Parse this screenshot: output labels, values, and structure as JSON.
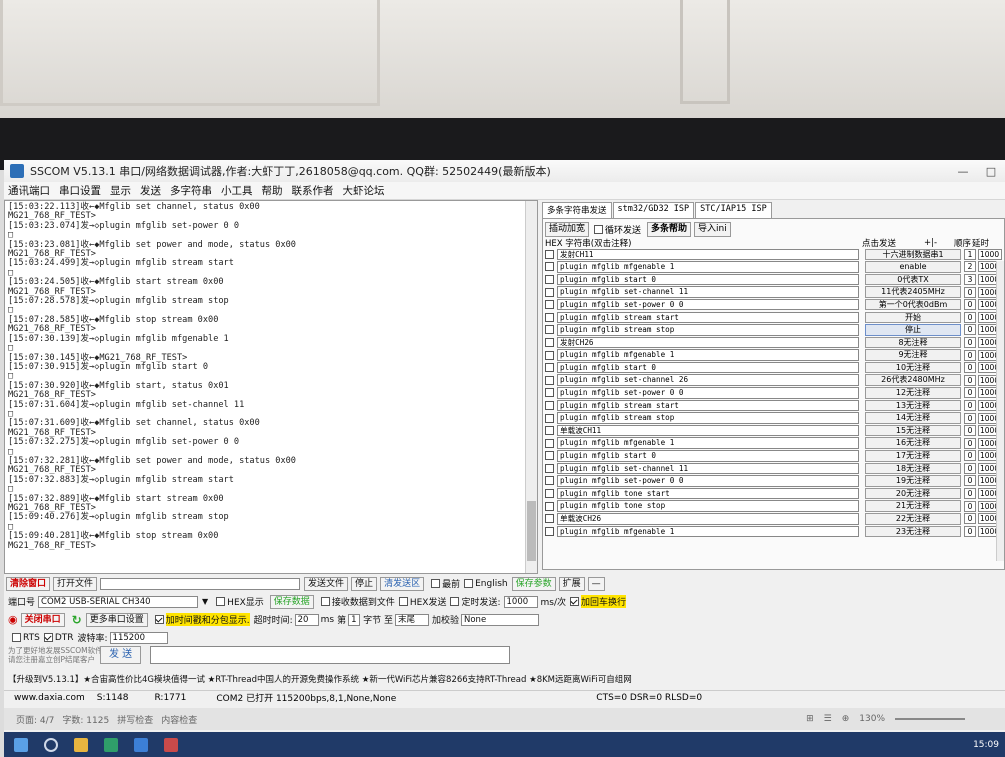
{
  "window": {
    "title": "SSCOM V5.13.1 串口/网络数据调试器,作者:大虾丁丁,2618058@qq.com. QQ群: 52502449(最新版本)",
    "minimize": "—",
    "maximize": "□"
  },
  "menu": [
    "通讯端口",
    "串口设置",
    "显示",
    "发送",
    "多字符串",
    "小工具",
    "帮助",
    "联系作者",
    "大虾论坛"
  ],
  "log_lines": [
    "[15:03:22.113]收←◆Mfglib set channel, status 0x00",
    "MG21_768_RF_TEST>",
    "[15:03:23.074]发→◇plugin mfglib set-power 0 0",
    "□",
    "[15:03:23.081]收←◆Mfglib set power and mode, status 0x00",
    "MG21_768_RF_TEST>",
    "[15:03:24.499]发→◇plugin mfglib stream start",
    "□",
    "[15:03:24.505]收←◆Mfglib start stream 0x00",
    "MG21_768_RF_TEST>",
    "[15:07:28.578]发→◇plugin mfglib stream stop",
    "□",
    "[15:07:28.585]收←◆Mfglib stop stream 0x00",
    "MG21_768_RF_TEST>",
    "[15:07:30.139]发→◇plugin mfglib mfgenable 1",
    "□",
    "[15:07:30.145]收←◆MG21_768_RF_TEST>",
    "[15:07:30.915]发→◇plugin mfglib start 0",
    "□",
    "[15:07:30.920]收←◆Mfglib start, status 0x01",
    "MG21_768_RF_TEST>",
    "[15:07:31.604]发→◇plugin mfglib set-channel 11",
    "□",
    "[15:07:31.609]收←◆Mfglib set channel, status 0x00",
    "MG21_768_RF_TEST>",
    "[15:07:32.275]发→◇plugin mfglib set-power 0 0",
    "□",
    "[15:07:32.281]收←◆Mfglib set power and mode, status 0x00",
    "MG21_768_RF_TEST>",
    "[15:07:32.883]发→◇plugin mfglib stream start",
    "□",
    "[15:07:32.889]收←◆Mfglib start stream 0x00",
    "MG21_768_RF_TEST>",
    "[15:09:40.276]发→◇plugin mfglib stream stop",
    "□",
    "[15:09:40.281]收←◆Mfglib stop stream 0x00",
    "MG21_768_RF_TEST>"
  ],
  "tabs": [
    "多条字符串发送",
    "stm32/GD32 ISP",
    "STC/IAP15 ISP"
  ],
  "multi_toolbar": {
    "insert": "插动加宽",
    "loop": "循环发送",
    "help": "多条帮助",
    "import": "导入ini"
  },
  "multi_header": {
    "hex_col": "HEX 字符串(双击注释)",
    "click_send": "点击发送",
    "order": "顺序",
    "delay": "延时",
    "unit": "ms",
    "sort_btns": "+|-"
  },
  "multi_rows": [
    {
      "text": "发射CH11",
      "btn": "十六进制数据串1",
      "ord": "1",
      "delay": "1000"
    },
    {
      "text": "plugin mfglib mfgenable 1",
      "btn": "enable",
      "ord": "2",
      "delay": "1000"
    },
    {
      "text": "plugin mfglib start 0",
      "btn": "0代表TX",
      "ord": "3",
      "delay": "1000"
    },
    {
      "text": "plugin mfglib set-channel 11",
      "btn": "11代表2405MHz",
      "ord": "0",
      "delay": "1000"
    },
    {
      "text": "plugin mfglib set-power 0 0",
      "btn": "第一个0代表0dBm",
      "ord": "0",
      "delay": "1000"
    },
    {
      "text": "plugin mfglib stream start",
      "btn": "开始",
      "ord": "0",
      "delay": "1000"
    },
    {
      "text": "plugin mfglib stream stop",
      "btn": "停止",
      "ord": "0",
      "delay": "1000"
    },
    {
      "text": "发射CH26",
      "btn": "8无注释",
      "ord": "0",
      "delay": "1000"
    },
    {
      "text": "plugin mfglib mfgenable 1",
      "btn": "9无注释",
      "ord": "0",
      "delay": "1000"
    },
    {
      "text": "plugin mfglib start 0",
      "btn": "10无注释",
      "ord": "0",
      "delay": "1000"
    },
    {
      "text": "plugin mfglib set-channel 26",
      "btn": "26代表2480MHz",
      "ord": "0",
      "delay": "1000"
    },
    {
      "text": "plugin mfglib set-power 0 0",
      "btn": "12无注释",
      "ord": "0",
      "delay": "1000"
    },
    {
      "text": "plugin mfglib stream start",
      "btn": "13无注释",
      "ord": "0",
      "delay": "1000"
    },
    {
      "text": "plugin mfglib stream stop",
      "btn": "14无注释",
      "ord": "0",
      "delay": "1000"
    },
    {
      "text": "单载波CH11",
      "btn": "15无注释",
      "ord": "0",
      "delay": "1000"
    },
    {
      "text": "plugin mfglib mfgenable 1",
      "btn": "16无注释",
      "ord": "0",
      "delay": "1000"
    },
    {
      "text": "plugin mfglib start 0",
      "btn": "17无注释",
      "ord": "0",
      "delay": "1000"
    },
    {
      "text": "plugin mfglib set-channel 11",
      "btn": "18无注释",
      "ord": "0",
      "delay": "1000"
    },
    {
      "text": "plugin mfglib set-power 0 0",
      "btn": "19无注释",
      "ord": "0",
      "delay": "1000"
    },
    {
      "text": "plugin mfglib tone start",
      "btn": "20无注释",
      "ord": "0",
      "delay": "1000"
    },
    {
      "text": "plugin mfglib tone stop",
      "btn": "21无注释",
      "ord": "0",
      "delay": "1000"
    },
    {
      "text": "单载波CH26",
      "btn": "22无注释",
      "ord": "0",
      "delay": "1000"
    },
    {
      "text": "plugin mfglib mfgenable 1",
      "btn": "23无注释",
      "ord": "0",
      "delay": "1000"
    }
  ],
  "controls": {
    "clear_window": "清除窗口",
    "open_file": "打开文件",
    "send_file": "发送文件",
    "stop": "停止",
    "clear_send": "清发送区",
    "topmost": "最前",
    "english": "English",
    "save_params": "保存参数",
    "expand": "扩展",
    "collapse": "—",
    "port_label": "端口号",
    "port_value": "COM2 USB-SERIAL CH340",
    "hex_display": "HEX显示",
    "save_data": "保存数据",
    "recv_to_file": "接收数据到文件",
    "hex_send": "HEX发送",
    "timed_send": "定时发送:",
    "timed_value": "1000",
    "timed_unit": "ms/次",
    "add_crlf": "加回车换行",
    "close_port": "关闭串口",
    "more_settings": "更多串口设置",
    "timestamp": "加时间戳和分包显示.",
    "timeout_label": "超时时间:",
    "timeout_value": "20",
    "timeout_unit": "ms",
    "frame_label": "第",
    "frame_value": "1",
    "byte_label": "字节 至",
    "end_value": "末尾",
    "checksum_label": "加校验",
    "checksum_value": "None",
    "rts": "RTS",
    "dtr": "DTR",
    "baud_label": "波特率:",
    "baud_value": "115200",
    "hint_line1": "为了更好地发展SSCOM软件",
    "hint_line2": "请您注册嘉立创P结尾客户",
    "send": "发 送",
    "banner": "【升级到V5.13.1】★合宙高性价比4G模块值得一试 ★RT-Thread中国人的开源免费操作系统 ★新一代WiFi芯片兼容8266支持RT-Thread ★8KM远距离WiFi可自组网"
  },
  "status": {
    "site": "www.daxia.com",
    "sent": "S:1148",
    "recv": "R:1771",
    "port_state": "COM2 已打开  115200bps,8,1,None,None",
    "lines": "CTS=0 DSR=0 RLSD=0"
  },
  "word": {
    "page": "页面: 4/7",
    "words": "字数: 1125",
    "spell": "拼写检查",
    "content_check": "内容检查",
    "zoom": "130%"
  },
  "clock": "15:09"
}
